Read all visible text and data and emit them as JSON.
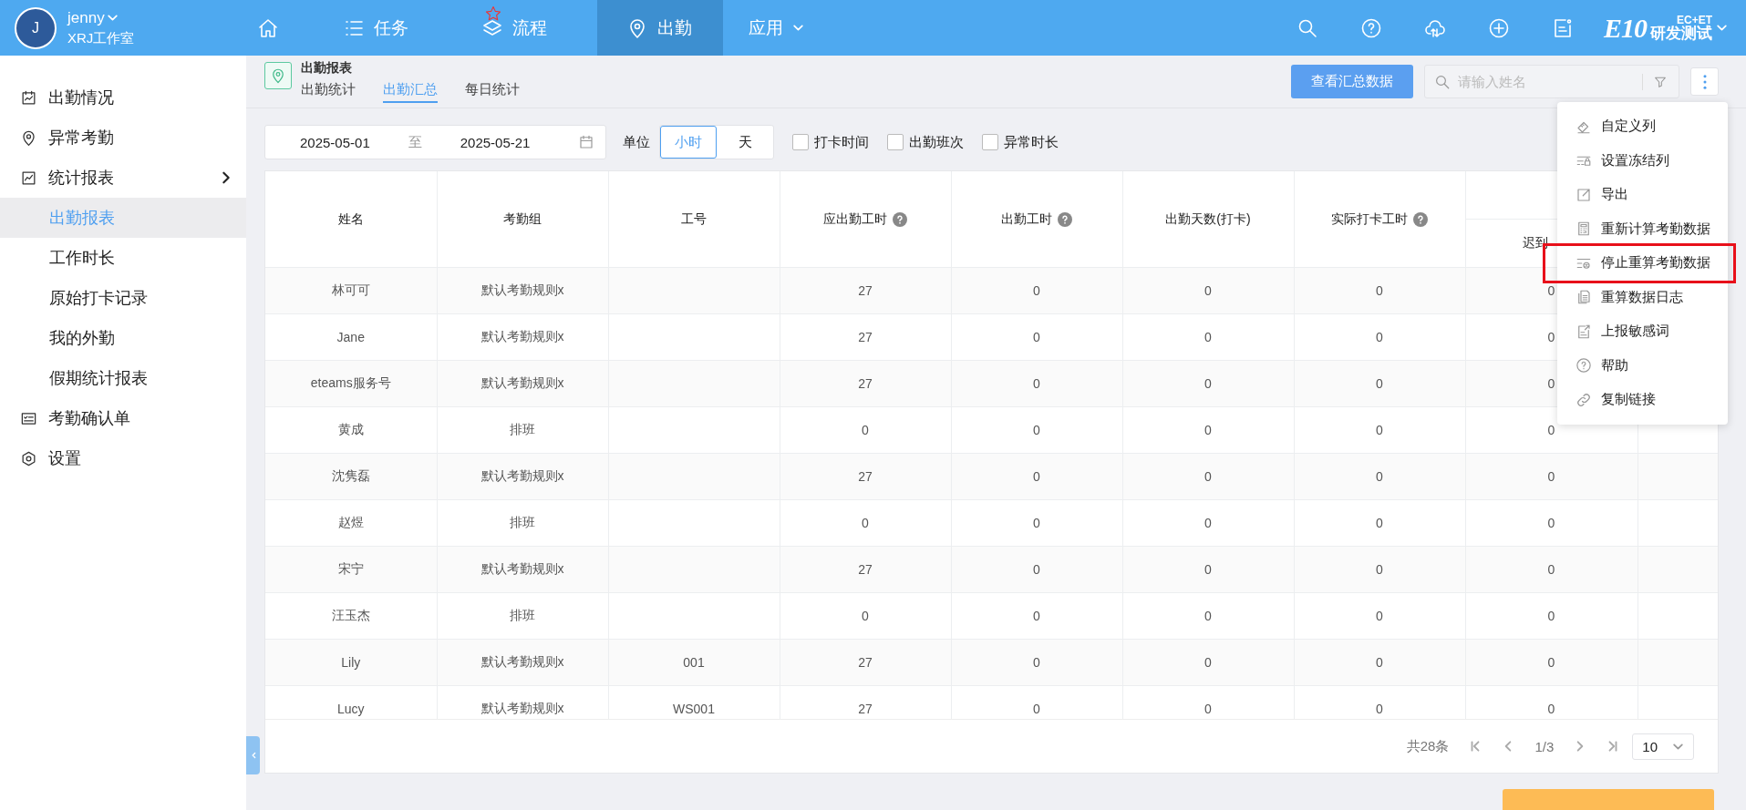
{
  "user": {
    "avatar": "J",
    "name": "jenny",
    "org": "XRJ工作室"
  },
  "nav": [
    {
      "kind": "home",
      "selected": false,
      "starred": false,
      "dropdown": false
    },
    {
      "kind": "list",
      "label": "任务",
      "selected": false,
      "starred": false,
      "dropdown": false
    },
    {
      "kind": "layers",
      "label": "流程",
      "selected": false,
      "starred": true,
      "dropdown": false
    },
    {
      "kind": "pin",
      "label": "出勤",
      "selected": true,
      "starred": false,
      "dropdown": false
    },
    {
      "kind": "none",
      "label": "应用",
      "selected": false,
      "starred": false,
      "dropdown": true
    }
  ],
  "toolbar": [
    {
      "kind": "search"
    },
    {
      "kind": "help"
    },
    {
      "kind": "cloud"
    },
    {
      "kind": "plus"
    },
    {
      "kind": "note"
    }
  ],
  "brand": {
    "logo": "E10",
    "top": "EC+ET",
    "bottom": "研发测试"
  },
  "sidebar": {
    "items": [
      {
        "kind": "chart",
        "label": "出勤情况",
        "selected": false
      },
      {
        "kind": "pin",
        "label": "异常考勤",
        "selected": false
      },
      {
        "kind": "trend",
        "label": "统计报表",
        "selected": false,
        "children": [
          {
            "label": "出勤报表",
            "selected": true
          },
          {
            "label": "工作时长",
            "selected": false
          },
          {
            "label": "原始打卡记录",
            "selected": false
          },
          {
            "label": "我的外勤",
            "selected": false
          },
          {
            "label": "假期统计报表",
            "selected": false
          }
        ]
      },
      {
        "kind": "card",
        "label": "考勤确认单",
        "selected": false
      },
      {
        "kind": "gear",
        "label": "设置",
        "selected": false
      }
    ]
  },
  "header": {
    "title": "出勤报表",
    "tabs": [
      {
        "label": "出勤统计",
        "selected": false
      },
      {
        "label": "出勤汇总",
        "selected": true
      },
      {
        "label": "每日统计",
        "selected": false
      }
    ],
    "button": "查看汇总数据",
    "search": {
      "placeholder": "请输入姓名"
    }
  },
  "filters": {
    "date_from": "2025-05-01",
    "separator": "至",
    "date_to": "2025-05-21",
    "unit_label": "单位",
    "units": [
      {
        "label": "小时",
        "selected": true
      },
      {
        "label": "天",
        "selected": false
      }
    ],
    "checkboxes": [
      {
        "label": "打卡时间",
        "checked": false
      },
      {
        "label": "出勤班次",
        "checked": false
      },
      {
        "label": "异常时长",
        "checked": false
      }
    ]
  },
  "table": {
    "columns": [
      {
        "label": "姓名",
        "help": false
      },
      {
        "label": "考勤组",
        "help": false
      },
      {
        "label": "工号",
        "help": false
      },
      {
        "label": "应出勤工时",
        "help": true
      },
      {
        "label": "出勤工时",
        "help": true
      },
      {
        "label": "出勤天数(打卡)",
        "help": false
      },
      {
        "label": "实际打卡工时",
        "help": true
      }
    ],
    "subcolumns": [
      "迟到"
    ],
    "rows": [
      [
        "林可可",
        "默认考勤规则x",
        "",
        "27",
        "0",
        "0",
        "0",
        "0"
      ],
      [
        "Jane",
        "默认考勤规则x",
        "",
        "27",
        "0",
        "0",
        "0",
        "0"
      ],
      [
        "eteams服务号",
        "默认考勤规则x",
        "",
        "27",
        "0",
        "0",
        "0",
        "0"
      ],
      [
        "黄成",
        "排班",
        "",
        "0",
        "0",
        "0",
        "0",
        "0"
      ],
      [
        "沈隽磊",
        "默认考勤规则x",
        "",
        "27",
        "0",
        "0",
        "0",
        "0"
      ],
      [
        "赵煜",
        "排班",
        "",
        "0",
        "0",
        "0",
        "0",
        "0"
      ],
      [
        "宋宁",
        "默认考勤规则x",
        "",
        "27",
        "0",
        "0",
        "0",
        "0"
      ],
      [
        "汪玉杰",
        "排班",
        "",
        "0",
        "0",
        "0",
        "0",
        "0"
      ],
      [
        "Lily",
        "默认考勤规则x",
        "001",
        "27",
        "0",
        "0",
        "0",
        "0"
      ],
      [
        "Lucy",
        "默认考勤规则x",
        "WS001",
        "27",
        "0",
        "0",
        "0",
        "0"
      ]
    ]
  },
  "pagination": {
    "total": "共28条",
    "page": "1/3",
    "page_size": "10"
  },
  "menu": [
    {
      "kind": "ruler",
      "label": "自定义列",
      "highlighted": false
    },
    {
      "kind": "lock",
      "label": "设置冻结列",
      "highlighted": false
    },
    {
      "kind": "export",
      "label": "导出",
      "highlighted": false
    },
    {
      "kind": "calc",
      "label": "重新计算考勤数据",
      "highlighted": false
    },
    {
      "kind": "stop",
      "label": "停止重算考勤数据",
      "highlighted": true
    },
    {
      "kind": "doc",
      "label": "重算数据日志",
      "highlighted": false
    },
    {
      "kind": "report",
      "label": "上报敏感词",
      "highlighted": false
    },
    {
      "kind": "help",
      "label": "帮助",
      "highlighted": false
    },
    {
      "kind": "link",
      "label": "复制链接",
      "highlighted": false
    }
  ]
}
